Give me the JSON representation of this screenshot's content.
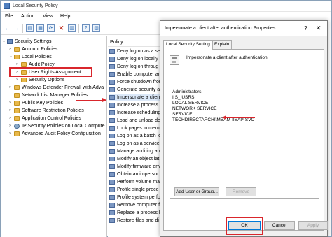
{
  "window": {
    "title": "Local Security Policy"
  },
  "menu": [
    "File",
    "Action",
    "View",
    "Help"
  ],
  "tree": {
    "items": [
      {
        "label": "Security Settings",
        "level": 0,
        "chev": "⌄",
        "icon": "shield"
      },
      {
        "label": "Account Policies",
        "level": 1,
        "chev": "›",
        "icon": "folder"
      },
      {
        "label": "Local Policies",
        "level": 1,
        "chev": "⌄",
        "icon": "folder"
      },
      {
        "label": "Audit Policy",
        "level": 2,
        "chev": "›",
        "icon": "folder"
      },
      {
        "label": "User Rights Assignment",
        "level": 2,
        "chev": "›",
        "icon": "folder"
      },
      {
        "label": "Security Options",
        "level": 2,
        "chev": "›",
        "icon": "folder"
      },
      {
        "label": "Windows Defender Firewall with Adva",
        "level": 1,
        "chev": "›",
        "icon": "folder"
      },
      {
        "label": "Network List Manager Policies",
        "level": 1,
        "chev": "",
        "icon": "folder"
      },
      {
        "label": "Public Key Policies",
        "level": 1,
        "chev": "›",
        "icon": "folder"
      },
      {
        "label": "Software Restriction Policies",
        "level": 1,
        "chev": "›",
        "icon": "folder"
      },
      {
        "label": "Application Control Policies",
        "level": 1,
        "chev": "›",
        "icon": "folder"
      },
      {
        "label": "IP Security Policies on Local Compute",
        "level": 1,
        "chev": "›",
        "icon": "gear"
      },
      {
        "label": "Advanced Audit Policy Configuration",
        "level": 1,
        "chev": "›",
        "icon": "folder"
      }
    ]
  },
  "policy_list": {
    "header": "Policy",
    "rows": [
      "Deny log on as a ser",
      "Deny log on locally",
      "Deny log on throug",
      "Enable computer an",
      "Force shutdown fron",
      "Generate security au",
      "Impersonate a client",
      "Increase a process w",
      "Increase scheduling",
      "Load and unload dev",
      "Lock pages in mem",
      "Log on as a batch jo",
      "Log on as a service",
      "Manage auditing an",
      "Modify an object lat",
      "Modify firmware env",
      "Obtain an impersor",
      "Perform volume mai",
      "Profile single proce",
      "Profile system perfo",
      "Remove computer f",
      "Replace a process le",
      "Restore files and di"
    ]
  },
  "dialog": {
    "title": "Impersonate a client after authentication Properties",
    "help": "?",
    "close": "✕",
    "tabs": [
      "Local Security Setting",
      "Explain"
    ],
    "policy_name": "Impersonate a client after authentication",
    "accounts": [
      "Administrators",
      "IIS_IUSRS",
      "LOCAL SERVICE",
      "NETWORK SERVICE",
      "SERVICE",
      "TECHDIRECTARCHI\\MBAM-IISAP-SVC"
    ],
    "add_button": "Add User or Group...",
    "remove_button": "Remove",
    "ok_button": "OK",
    "cancel_button": "Cancel",
    "apply_button": "Apply"
  },
  "colors": {
    "annotation_red": "#d9262c",
    "selection": "#dbe8f8",
    "accent": "#0078d7"
  }
}
